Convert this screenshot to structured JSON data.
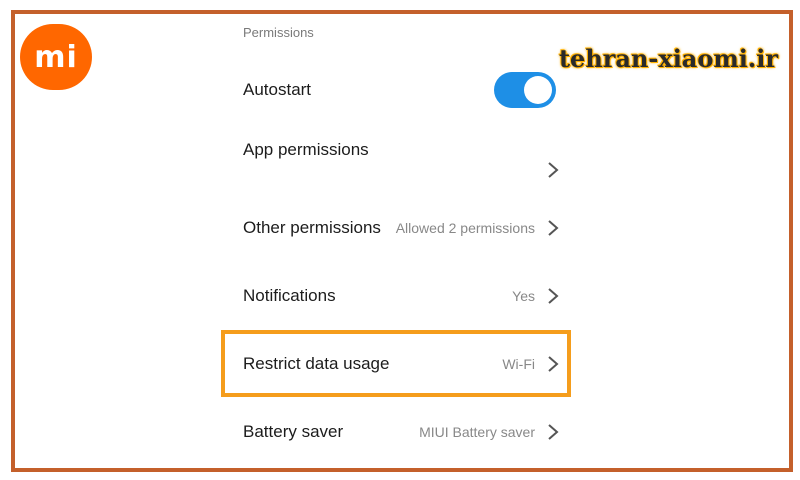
{
  "logo": {
    "text": "mi"
  },
  "watermark": {
    "text": "tehran-xiaomi.ir"
  },
  "permissions": {
    "section_title": "Permissions",
    "autostart": {
      "label": "Autostart",
      "enabled": true
    },
    "items": [
      {
        "label": "App permissions",
        "value": ""
      },
      {
        "label": "Other permissions",
        "value": "Allowed 2 permissions"
      },
      {
        "label": "Notifications",
        "value": "Yes"
      },
      {
        "label": "Restrict data usage",
        "value": "Wi-Fi",
        "highlighted": true
      },
      {
        "label": "Battery saver",
        "value": "MIUI Battery saver"
      }
    ]
  },
  "colors": {
    "brand_orange": "#ff6700",
    "frame": "#c4602b",
    "toggle_on": "#1e8fe6",
    "highlight": "#f59d1c"
  }
}
